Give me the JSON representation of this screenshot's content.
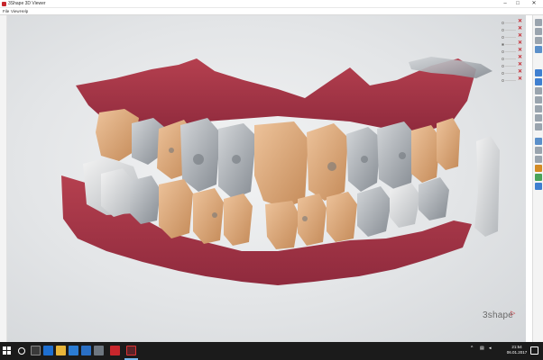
{
  "window": {
    "title": "3Shape 3D Viewer",
    "minimize": "–",
    "maximize": "□",
    "close": "✕"
  },
  "menu": {
    "items": [
      "File",
      "View",
      "Help"
    ]
  },
  "brand": {
    "name": "3shape",
    "mark": "▷"
  },
  "layers": {
    "count": 9,
    "remove_glyph": "✕"
  },
  "toolbar": {
    "icons": [
      "cube-icon",
      "cube-icon",
      "cube-icon",
      "layers-icon",
      "view-front-icon",
      "view-left-icon",
      "view-right-icon",
      "view-top-icon",
      "view-bottom-icon",
      "view-back-icon",
      "zoom-icon",
      "rotate-icon",
      "section-icon",
      "screenshot-icon",
      "measure-icon",
      "pen-icon",
      "check-icon"
    ]
  },
  "taskbar": {
    "icons": [
      "task-view-icon",
      "edge-icon",
      "explorer-icon",
      "store-icon",
      "mail-icon",
      "app-icon",
      "red-app-icon",
      "viewer-app-icon"
    ],
    "clock": {
      "time": "21:54",
      "date": "06.01.2017"
    }
  },
  "colors": {
    "gum": "#a8344a",
    "tooth_gold": "#d7a071",
    "tooth_gray": "#a3a8ad",
    "accent_red": "#c4232b",
    "taskbar": "#1b1b1b"
  }
}
